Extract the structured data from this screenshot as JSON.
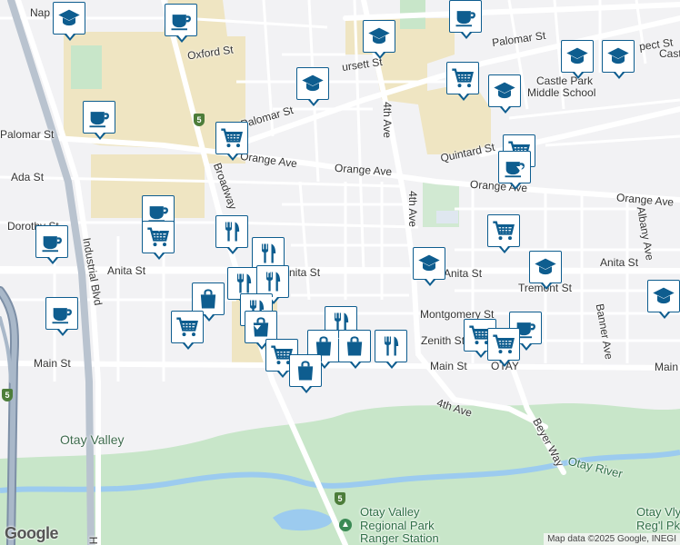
{
  "map": {
    "streets": {
      "oxford": "Oxford St",
      "palomar_north": "Palomar St",
      "palomar_west": "Palomar St",
      "palomar_mid": "Palomar St",
      "orange_west": "Orange Ave",
      "orange_mid": "Orange Ave",
      "orange_east": "Orange Ave",
      "orange_far": "Orange Ave",
      "quintard": "Quintard St",
      "ada": "Ada St",
      "dorothy": "Dorothy St",
      "anita_west": "Anita St",
      "anita_mid": "Anita St",
      "anita_east": "Anita St",
      "anita_right": "Anita St",
      "tremont": "Tremont St",
      "montgomery": "Montgomery St",
      "zenith": "Zenith St",
      "main_west": "Main St",
      "main_mid": "Main St",
      "main_east": "Main St",
      "fourth_ave_north": "4th Ave",
      "fourth_ave_mid": "4th Ave",
      "fourth_ave_south": "4th Ave",
      "broadway": "Broadway",
      "industrial": "Industrial Blvd",
      "albany": "Albany Ave",
      "banner": "Banner Ave",
      "beyer": "Beyer Way",
      "hursett": "ursett St",
      "prospect": "pect St",
      "napa": "Nap",
      "cast": "Cast",
      "h_road": "H"
    },
    "places": {
      "castle_park": "Castle Park",
      "castle_park_school": "Middle School",
      "otay_valley": "Otay Valley",
      "otay_river": "Otay River",
      "ranger_1": "Otay Valley",
      "ranger_2": "Regional Park",
      "ranger_3": "Ranger Station",
      "otay_vly_1": "Otay Vly",
      "otay_vly_2": "Reg'l Pk",
      "otay_town": "OTAY"
    },
    "shields": {
      "i5_a": "5",
      "i5_b": "5",
      "i5_c": "5"
    },
    "google_logo": "Google",
    "attribution": "Map data ©2025 Google, INEGI",
    "colors": {
      "pin_border": "#0e5d8f",
      "pin_icon": "#0e5d8f",
      "park": "#c8e6c9",
      "school_zone": "#efe5c2",
      "water": "#9ccbef",
      "road": "#ffffff",
      "highway": "#b9c3cf"
    }
  },
  "markers": [
    {
      "type": "school",
      "icon": "graduation-cap-icon"
    },
    {
      "type": "cafe",
      "icon": "coffee-cup-icon"
    },
    {
      "type": "school",
      "icon": "graduation-cap-icon"
    },
    {
      "type": "cafe",
      "icon": "coffee-cup-icon"
    },
    {
      "type": "school",
      "icon": "graduation-cap-icon"
    },
    {
      "type": "school",
      "icon": "graduation-cap-icon"
    },
    {
      "type": "school",
      "icon": "graduation-cap-icon"
    },
    {
      "type": "grocery",
      "icon": "shopping-cart-icon"
    },
    {
      "type": "school",
      "icon": "graduation-cap-icon"
    },
    {
      "type": "cafe",
      "icon": "coffee-cup-icon"
    },
    {
      "type": "grocery",
      "icon": "shopping-cart-icon"
    },
    {
      "type": "grocery",
      "icon": "shopping-cart-icon"
    },
    {
      "type": "cafe",
      "icon": "coffee-cup-icon"
    },
    {
      "type": "cafe",
      "icon": "coffee-cup-icon"
    },
    {
      "type": "grocery",
      "icon": "shopping-cart-icon"
    },
    {
      "type": "cafe",
      "icon": "coffee-cup-icon"
    },
    {
      "type": "restaurant",
      "icon": "fork-knife-icon"
    },
    {
      "type": "restaurant",
      "icon": "fork-knife-icon"
    },
    {
      "type": "grocery",
      "icon": "shopping-cart-icon"
    },
    {
      "type": "school",
      "icon": "graduation-cap-icon"
    },
    {
      "type": "school",
      "icon": "graduation-cap-icon"
    },
    {
      "type": "school",
      "icon": "graduation-cap-icon"
    },
    {
      "type": "restaurant",
      "icon": "fork-knife-icon"
    },
    {
      "type": "restaurant",
      "icon": "fork-knife-icon"
    },
    {
      "type": "restaurant",
      "icon": "fork-knife-icon"
    },
    {
      "type": "shopping",
      "icon": "shopping-bag-icon"
    },
    {
      "type": "cafe",
      "icon": "coffee-cup-icon"
    },
    {
      "type": "grocery",
      "icon": "shopping-cart-icon"
    },
    {
      "type": "shopping",
      "icon": "shopping-bag-icon"
    },
    {
      "type": "restaurant",
      "icon": "fork-knife-icon"
    },
    {
      "type": "shopping",
      "icon": "shopping-bag-icon"
    },
    {
      "type": "shopping",
      "icon": "shopping-bag-icon"
    },
    {
      "type": "restaurant",
      "icon": "fork-knife-icon"
    },
    {
      "type": "grocery",
      "icon": "shopping-cart-icon"
    },
    {
      "type": "grocery",
      "icon": "shopping-cart-icon"
    },
    {
      "type": "shopping",
      "icon": "shopping-bag-icon"
    },
    {
      "type": "cafe",
      "icon": "coffee-cup-icon"
    },
    {
      "type": "grocery",
      "icon": "shopping-cart-icon"
    }
  ]
}
